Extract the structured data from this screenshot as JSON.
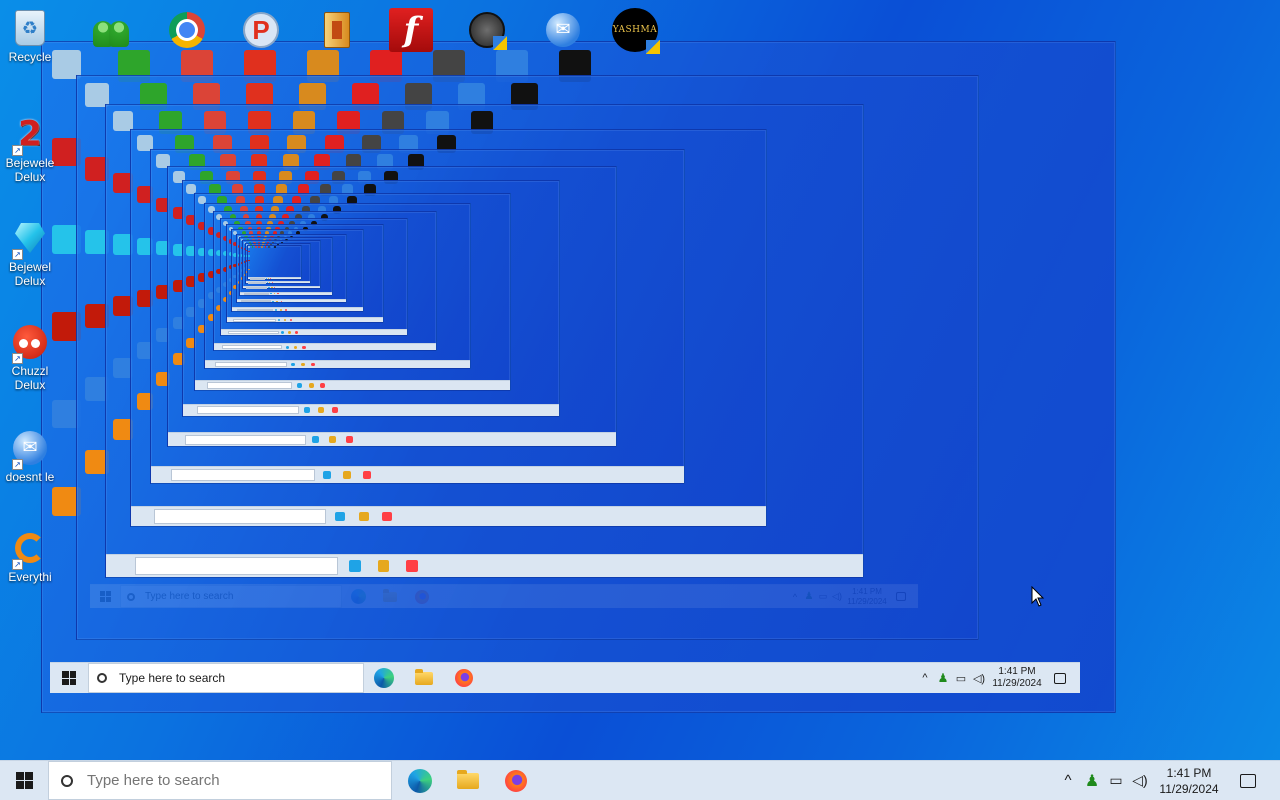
{
  "desktop": {
    "left_icons": [
      {
        "label": "Recycle",
        "icon": "recycle-bin-icon"
      },
      {
        "label": "Bejewele\nDelux",
        "icon": "bejeweled-2-icon"
      },
      {
        "label": "Bejewel\nDelux",
        "icon": "bejeweled-gem-icon"
      },
      {
        "label": "Chuzzl\nDelux",
        "icon": "chuzzle-icon"
      },
      {
        "label": "doesnt le",
        "icon": "mail-globe-icon"
      },
      {
        "label": "Everythi",
        "icon": "everything-search-icon"
      }
    ],
    "top_icons": [
      {
        "icon": "people-icon"
      },
      {
        "icon": "chrome-icon"
      },
      {
        "icon": "p-app-icon"
      },
      {
        "icon": "book-archive-icon"
      },
      {
        "icon": "flash-icon"
      },
      {
        "icon": "mixer-app-icon"
      },
      {
        "icon": "mail-globe-icon"
      },
      {
        "icon": "yashma-icon",
        "text": "YASHMA"
      }
    ]
  },
  "taskbar": {
    "search_placeholder": "Type here to search",
    "apps": [
      "edge-icon",
      "file-explorer-icon",
      "firefox-icon"
    ],
    "tray": {
      "time": "1:41 PM",
      "date": "11/29/2024"
    }
  },
  "colors": {
    "taskbar_bg": "#dce7f3",
    "desktop_blue": "#0b72e0",
    "accent_red": "#e02020"
  }
}
